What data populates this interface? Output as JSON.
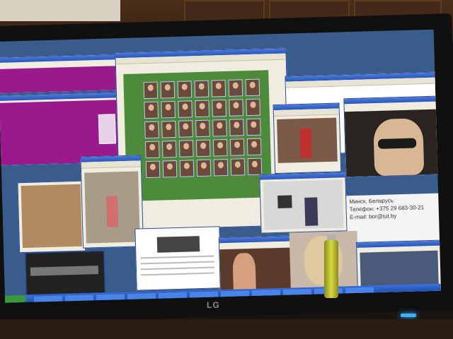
{
  "monitor": {
    "brand": "LG"
  },
  "contact_card": {
    "city": "Минск, Беларусь",
    "phone": "Телефон: +375 29 683-30-21",
    "email": "E-mail: bor@tut.by"
  },
  "windows": [
    {
      "name": "photo-editor-window-left",
      "title": ""
    },
    {
      "name": "class-photo-viewer",
      "title": ""
    },
    {
      "name": "browser-window-top-right",
      "title": ""
    },
    {
      "name": "child-photo-viewer",
      "title": ""
    },
    {
      "name": "woman-sunglasses-viewer",
      "title": ""
    },
    {
      "name": "elderly-woman-viewer",
      "title": ""
    }
  ],
  "colors": {
    "desktop": "#3a5c8c",
    "taskbar": "#2a5cc0",
    "purple_window": "#9a1a8e",
    "power_led": "#3ab0ff"
  }
}
